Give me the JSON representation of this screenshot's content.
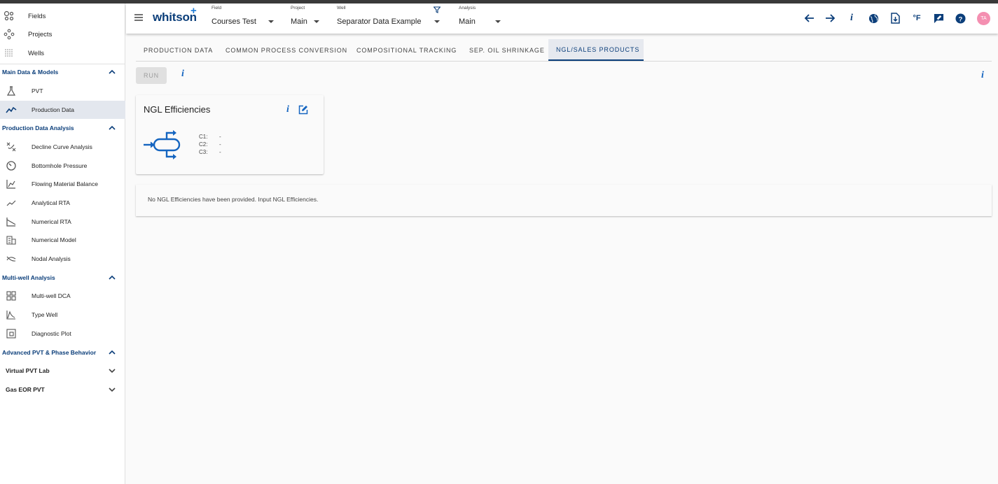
{
  "sidebar": {
    "top_items": [
      {
        "label": "Fields",
        "icon": "fields-icon"
      },
      {
        "label": "Projects",
        "icon": "projects-icon"
      },
      {
        "label": "Wells",
        "icon": "wells-icon"
      }
    ],
    "sections": [
      {
        "label": "Main Data & Models",
        "expanded": true,
        "items": [
          {
            "label": "PVT",
            "icon": "flask-icon"
          },
          {
            "label": "Production Data",
            "icon": "trend-icon",
            "active": true
          }
        ]
      },
      {
        "label": "Production Data Analysis",
        "expanded": true,
        "items": [
          {
            "label": "Decline Curve Analysis",
            "icon": "decline-icon"
          },
          {
            "label": "Bottomhole Pressure",
            "icon": "gauge-icon"
          },
          {
            "label": "Flowing Material Balance",
            "icon": "chart-line-icon"
          },
          {
            "label": "Analytical RTA",
            "icon": "analytics-icon"
          },
          {
            "label": "Numerical RTA",
            "icon": "slope-icon"
          },
          {
            "label": "Numerical Model",
            "icon": "grid-model-icon"
          },
          {
            "label": "Nodal Analysis",
            "icon": "nodal-icon"
          }
        ]
      },
      {
        "label": "Multi-well Analysis",
        "expanded": true,
        "items": [
          {
            "label": "Multi-well DCA",
            "icon": "grid-icon"
          },
          {
            "label": "Type Well",
            "icon": "type-well-icon"
          },
          {
            "label": "Diagnostic Plot",
            "icon": "diagnostic-icon"
          }
        ]
      },
      {
        "label": "Advanced PVT & Phase Behavior",
        "expanded": true,
        "items": []
      }
    ],
    "collapsed": [
      "Virtual PVT Lab",
      "Gas EOR PVT"
    ]
  },
  "header": {
    "logo": "whitson",
    "logo_plus": "+",
    "field": {
      "label": "Field",
      "value": "Courses Test"
    },
    "project": {
      "label": "Project",
      "value": "Main"
    },
    "well": {
      "label": "Well",
      "value": "Separator Data Example"
    },
    "analysis": {
      "label": "Analysis",
      "value": "Main"
    },
    "units_label": "°F",
    "info_label": "i",
    "avatar": "TA"
  },
  "tabs": [
    {
      "label": "PRODUCTION DATA"
    },
    {
      "label": "COMMON PROCESS CONVERSION"
    },
    {
      "label": "COMPOSITIONAL TRACKING"
    },
    {
      "label": "SEP. OIL SHRINKAGE"
    },
    {
      "label": "NGL/SALES PRODUCTS",
      "active": true
    }
  ],
  "run_label": "RUN",
  "info_label": "i",
  "card": {
    "title": "NGL Efficiencies",
    "components": [
      {
        "name": "C1:",
        "value": "-"
      },
      {
        "name": "C2:",
        "value": "-"
      },
      {
        "name": "C3:",
        "value": "-"
      }
    ]
  },
  "message": "No NGL Efficiencies have been provided. Input NGL Efficiencies.",
  "colors": {
    "brand": "#0b3e7a",
    "accent": "#1565c0",
    "avatar": "#f48fb1",
    "active_bg": "#e3e7ee"
  }
}
